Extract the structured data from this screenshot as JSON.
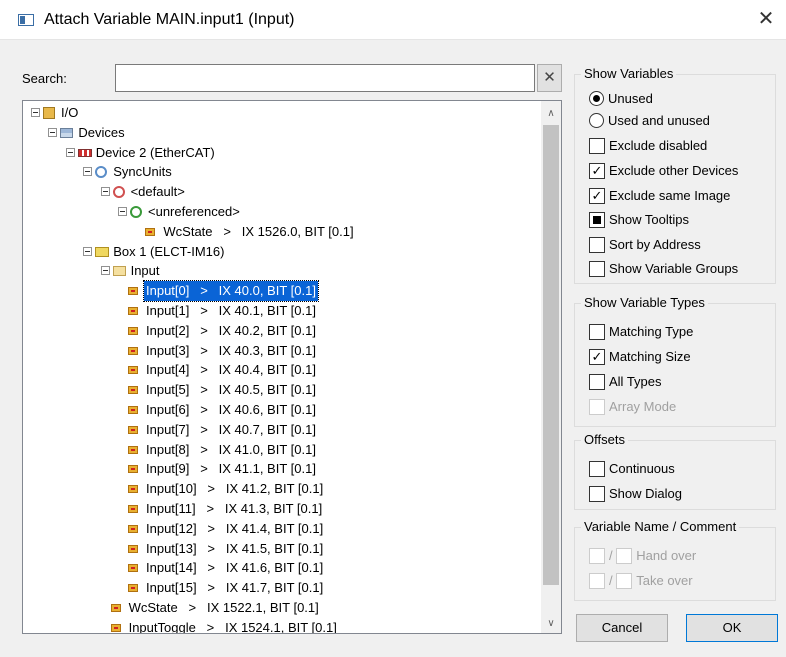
{
  "window": {
    "title": "Attach Variable MAIN.input1 (Input)",
    "close_glyph": "✕"
  },
  "search": {
    "label": "Search:",
    "value": "",
    "placeholder": "",
    "clear_glyph": "✕"
  },
  "tree": {
    "rows": [
      {
        "label": "I/O",
        "icon": "io-icon"
      },
      {
        "label": "Devices",
        "icon": "devices-icon"
      },
      {
        "label": "Device 2 (EtherCAT)",
        "icon": "ethercat-icon"
      },
      {
        "label": "SyncUnits",
        "icon": "syncunits-icon"
      },
      {
        "label": "<default>",
        "icon": "syncunit-default-icon"
      },
      {
        "label": "<unreferenced>",
        "icon": "syncunit-unreferenced-icon"
      },
      {
        "label": "WcState   >   IX 1526.0, BIT [0.1]",
        "icon": "input-var-icon"
      },
      {
        "label": "Box 1 (ELCT-IM16)",
        "icon": "box-icon"
      },
      {
        "label": "Input",
        "icon": "input-folder-icon"
      },
      {
        "label": "Input[0]   >   IX 40.0, BIT [0.1]",
        "icon": "input-var-icon"
      },
      {
        "label": "Input[1]   >   IX 40.1, BIT [0.1]",
        "icon": "input-var-icon"
      },
      {
        "label": "Input[2]   >   IX 40.2, BIT [0.1]",
        "icon": "input-var-icon"
      },
      {
        "label": "Input[3]   >   IX 40.3, BIT [0.1]",
        "icon": "input-var-icon"
      },
      {
        "label": "Input[4]   >   IX 40.4, BIT [0.1]",
        "icon": "input-var-icon"
      },
      {
        "label": "Input[5]   >   IX 40.5, BIT [0.1]",
        "icon": "input-var-icon"
      },
      {
        "label": "Input[6]   >   IX 40.6, BIT [0.1]",
        "icon": "input-var-icon"
      },
      {
        "label": "Input[7]   >   IX 40.7, BIT [0.1]",
        "icon": "input-var-icon"
      },
      {
        "label": "Input[8]   >   IX 41.0, BIT [0.1]",
        "icon": "input-var-icon"
      },
      {
        "label": "Input[9]   >   IX 41.1, BIT [0.1]",
        "icon": "input-var-icon"
      },
      {
        "label": "Input[10]   >   IX 41.2, BIT [0.1]",
        "icon": "input-var-icon"
      },
      {
        "label": "Input[11]   >   IX 41.3, BIT [0.1]",
        "icon": "input-var-icon"
      },
      {
        "label": "Input[12]   >   IX 41.4, BIT [0.1]",
        "icon": "input-var-icon"
      },
      {
        "label": "Input[13]   >   IX 41.5, BIT [0.1]",
        "icon": "input-var-icon"
      },
      {
        "label": "Input[14]   >   IX 41.6, BIT [0.1]",
        "icon": "input-var-icon"
      },
      {
        "label": "Input[15]   >   IX 41.7, BIT [0.1]",
        "icon": "input-var-icon"
      },
      {
        "label": "WcState   >   IX 1522.1, BIT [0.1]",
        "icon": "input-var-icon"
      },
      {
        "label": "InputToggle   >   IX 1524.1, BIT [0.1]",
        "icon": "input-var-icon"
      }
    ],
    "selected_label": "Input[0]   >   IX 40.0, BIT [0.1]",
    "scroll_up_glyph": "∧",
    "scroll_down_glyph": "∨"
  },
  "show_variables": {
    "title": "Show Variables",
    "unused": "Unused",
    "used_and_unused": "Used and unused",
    "exclude_disabled": "Exclude disabled",
    "exclude_other_devices": "Exclude other Devices",
    "exclude_same_image": "Exclude same Image",
    "show_tooltips": "Show Tooltips",
    "sort_by_address": "Sort by Address",
    "show_variable_groups": "Show Variable Groups",
    "selected": "Unused",
    "checked": [
      "Exclude other Devices",
      "Exclude same Image"
    ],
    "indeterminate": [
      "Show Tooltips"
    ]
  },
  "show_variable_types": {
    "title": "Show Variable Types",
    "matching_type": "Matching Type",
    "matching_size": "Matching Size",
    "all_types": "All Types",
    "array_mode": "Array Mode",
    "checked": [
      "Matching Size"
    ],
    "disabled": [
      "Array Mode"
    ]
  },
  "offsets": {
    "title": "Offsets",
    "continuous": "Continuous",
    "show_dialog": "Show Dialog"
  },
  "variable_name_comment": {
    "title": "Variable Name / Comment",
    "separator": "/",
    "hand_over": "Hand over",
    "take_over": "Take over"
  },
  "buttons": {
    "cancel": "Cancel",
    "ok": "OK"
  },
  "colors": {
    "selection": "#0a64d6",
    "default_button_border": "#0078d7"
  }
}
